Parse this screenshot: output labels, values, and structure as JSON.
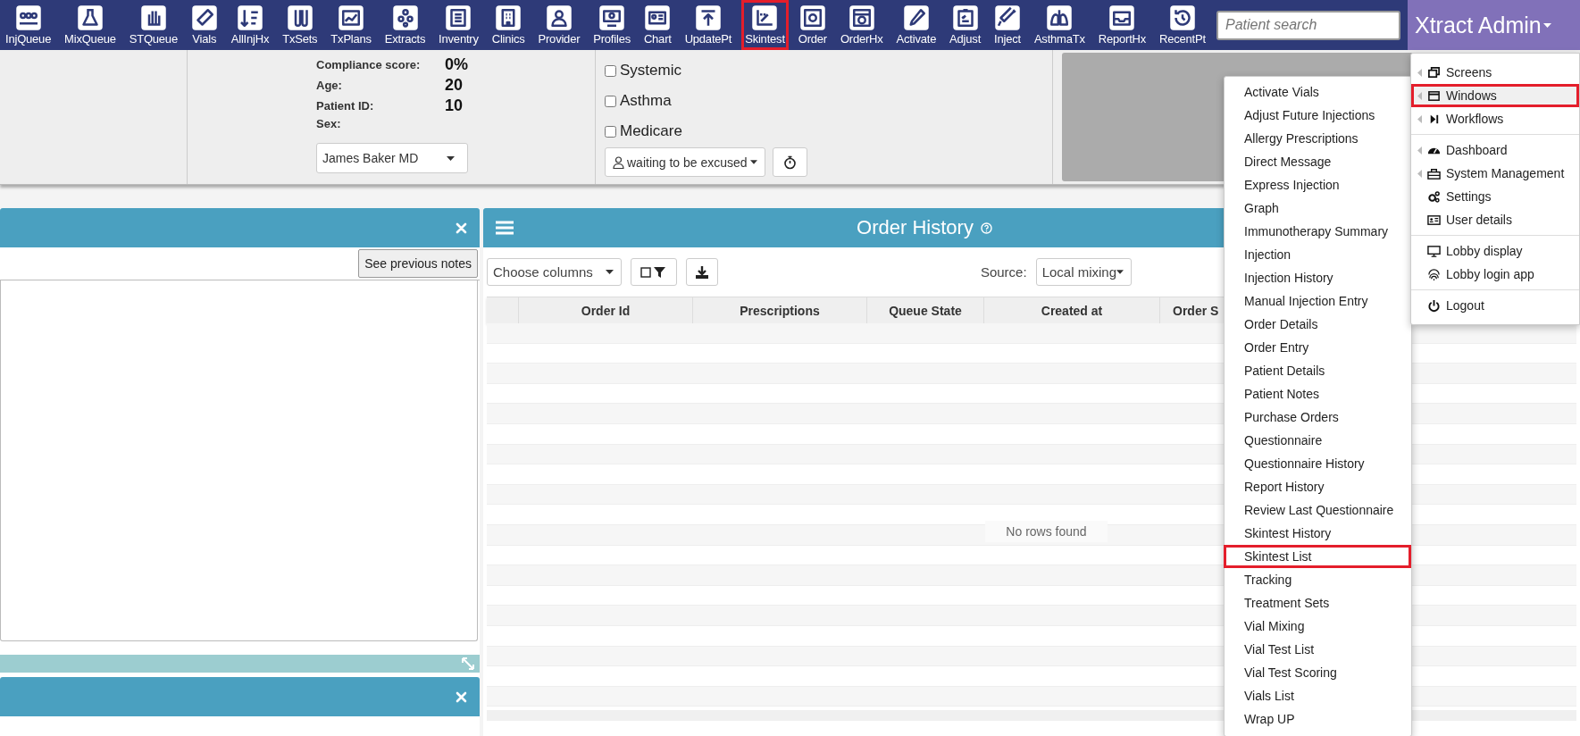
{
  "toolbar": {
    "items": [
      {
        "label": "InjQueue",
        "highlighted": false
      },
      {
        "label": "MixQueue",
        "highlighted": false
      },
      {
        "label": "STQueue",
        "highlighted": false
      },
      {
        "label": "Vials",
        "highlighted": false
      },
      {
        "label": "AllInjHx",
        "highlighted": false
      },
      {
        "label": "TxSets",
        "highlighted": false
      },
      {
        "label": "TxPlans",
        "highlighted": false
      },
      {
        "label": "Extracts",
        "highlighted": false
      },
      {
        "label": "Inventry",
        "highlighted": false
      },
      {
        "label": "Clinics",
        "highlighted": false
      },
      {
        "label": "Provider",
        "highlighted": false
      },
      {
        "label": "Profiles",
        "highlighted": false
      },
      {
        "label": "Chart",
        "highlighted": false
      },
      {
        "label": "UpdatePt",
        "highlighted": false
      },
      {
        "label": "Skintest",
        "highlighted": true
      },
      {
        "label": "Order",
        "highlighted": false
      },
      {
        "label": "OrderHx",
        "highlighted": false
      },
      {
        "label": "Activate",
        "highlighted": false
      },
      {
        "label": "Adjust",
        "highlighted": false
      },
      {
        "label": "Inject",
        "highlighted": false
      },
      {
        "label": "AsthmaTx",
        "highlighted": false
      },
      {
        "label": "ReportHx",
        "highlighted": false
      },
      {
        "label": "RecentPt",
        "highlighted": false
      }
    ]
  },
  "search": {
    "placeholder": "Patient search"
  },
  "user_menu": {
    "label": "Xtract Admin"
  },
  "patient": {
    "fields": [
      {
        "label": "Compliance score:",
        "value": "0%"
      },
      {
        "label": "Age:",
        "value": "20"
      },
      {
        "label": "Patient ID:",
        "value": "10"
      },
      {
        "label": "Sex:"
      }
    ],
    "provider": "James Baker MD",
    "flags": [
      {
        "label": "Systemic",
        "checked": false
      },
      {
        "label": "Asthma",
        "checked": false
      },
      {
        "label": "Medicare",
        "checked": false
      }
    ],
    "status": "waiting to be excused"
  },
  "notes_panel": {
    "button": "See previous notes"
  },
  "order_history": {
    "title": "Order History",
    "choose_columns": "Choose columns",
    "source_label": "Source:",
    "source": "Local mixing",
    "columns": [
      "Order Id",
      "Prescriptions",
      "Queue State",
      "Created at",
      "Order S"
    ],
    "empty_message": "No rows found"
  },
  "main_menu": {
    "groups": [
      [
        {
          "label": "Screens",
          "submenu": true,
          "highlighted": false
        },
        {
          "label": "Windows",
          "submenu": true,
          "highlighted": true
        },
        {
          "label": "Workflows",
          "submenu": true,
          "highlighted": false
        }
      ],
      [
        {
          "label": "Dashboard",
          "submenu": true,
          "highlighted": false
        },
        {
          "label": "System Management",
          "submenu": true,
          "highlighted": false
        },
        {
          "label": "Settings",
          "submenu": false,
          "highlighted": false
        },
        {
          "label": "User details",
          "submenu": false,
          "highlighted": false
        }
      ],
      [
        {
          "label": "Lobby display",
          "submenu": false,
          "highlighted": false
        },
        {
          "label": "Lobby login app",
          "submenu": false,
          "highlighted": false
        }
      ],
      [
        {
          "label": "Logout",
          "submenu": false,
          "highlighted": false
        }
      ]
    ]
  },
  "windows_menu": {
    "items": [
      {
        "label": "Activate Vials",
        "highlighted": false
      },
      {
        "label": "Adjust Future Injections",
        "highlighted": false
      },
      {
        "label": "Allergy Prescriptions",
        "highlighted": false
      },
      {
        "label": "Direct Message",
        "highlighted": false
      },
      {
        "label": "Express Injection",
        "highlighted": false
      },
      {
        "label": "Graph",
        "highlighted": false
      },
      {
        "label": "Immunotherapy Summary",
        "highlighted": false
      },
      {
        "label": "Injection",
        "highlighted": false
      },
      {
        "label": "Injection History",
        "highlighted": false
      },
      {
        "label": "Manual Injection Entry",
        "highlighted": false
      },
      {
        "label": "Order Details",
        "highlighted": false
      },
      {
        "label": "Order Entry",
        "highlighted": false
      },
      {
        "label": "Patient Details",
        "highlighted": false
      },
      {
        "label": "Patient Notes",
        "highlighted": false
      },
      {
        "label": "Purchase Orders",
        "highlighted": false
      },
      {
        "label": "Questionnaire",
        "highlighted": false
      },
      {
        "label": "Questionnaire History",
        "highlighted": false
      },
      {
        "label": "Report History",
        "highlighted": false
      },
      {
        "label": "Review Last Questionnaire",
        "highlighted": false
      },
      {
        "label": "Skintest History",
        "highlighted": false
      },
      {
        "label": "Skintest List",
        "highlighted": true
      },
      {
        "label": "Tracking",
        "highlighted": false
      },
      {
        "label": "Treatment Sets",
        "highlighted": false
      },
      {
        "label": "Vial Mixing",
        "highlighted": false
      },
      {
        "label": "Vial Test List",
        "highlighted": false
      },
      {
        "label": "Vial Test Scoring",
        "highlighted": false
      },
      {
        "label": "Vials List",
        "highlighted": false
      },
      {
        "label": "Wrap UP",
        "highlighted": false
      }
    ]
  }
}
